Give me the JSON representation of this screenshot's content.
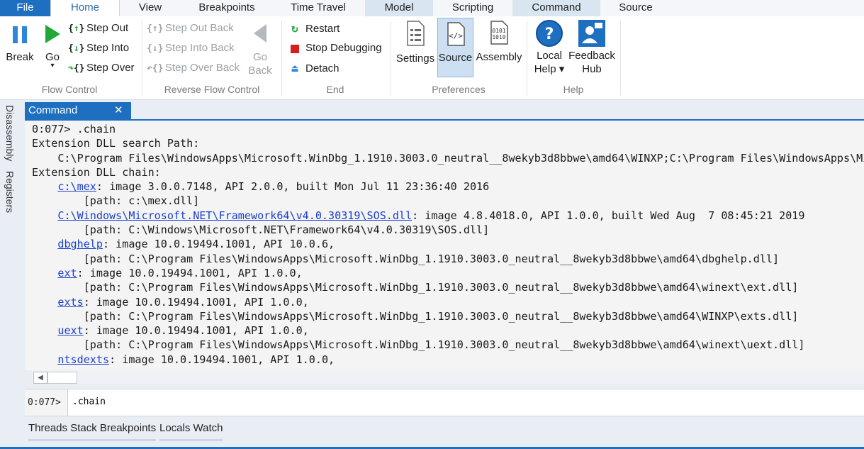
{
  "tabs": [
    "File",
    "Home",
    "View",
    "Breakpoints",
    "Time Travel",
    "Model",
    "Scripting",
    "Command",
    "Source"
  ],
  "ribbon": {
    "flow_control": {
      "label": "Flow Control",
      "break": "Break",
      "go": "Go",
      "go_arrow": "▾",
      "step_out": "Step Out",
      "step_into": "Step Into",
      "step_over": "Step Over"
    },
    "reverse_flow_control": {
      "label": "Reverse Flow Control",
      "step_out_back": "Step Out Back",
      "step_into_back": "Step Into Back",
      "step_over_back": "Step Over Back",
      "go_back_1": "Go",
      "go_back_2": "Back"
    },
    "end": {
      "label": "End",
      "restart": "Restart",
      "stop_debugging": "Stop Debugging",
      "detach": "Detach"
    },
    "preferences": {
      "label": "Preferences",
      "settings": "Settings",
      "source": "Source",
      "assembly": "Assembly"
    },
    "help": {
      "label": "Help",
      "local_help_1": "Local",
      "local_help_2": "Help ▾",
      "feedback_1": "Feedback",
      "feedback_2": "Hub"
    }
  },
  "side_tabs": [
    "Disassembly",
    "Registers"
  ],
  "command_window": {
    "title": "Command",
    "close_glyph": "✕",
    "output": [
      {
        "t": "0:077> .chain"
      },
      {
        "t": "Extension DLL search Path:"
      },
      {
        "t": "    C:\\Program Files\\WindowsApps\\Microsoft.WinDbg_1.1910.3003.0_neutral__8wekyb3d8bbwe\\amd64\\WINXP;C:\\Program Files\\WindowsApps\\Microsoft"
      },
      {
        "t": "Extension DLL chain:"
      },
      {
        "pre": "    ",
        "link": "c:\\mex",
        "t": ": image 3.0.0.7148, API 2.0.0, built Mon Jul 11 23:36:40 2016"
      },
      {
        "t": "        [path: c:\\mex.dll]"
      },
      {
        "pre": "    ",
        "link": "C:\\Windows\\Microsoft.NET\\Framework64\\v4.0.30319\\SOS.dll",
        "t": ": image 4.8.4018.0, API 1.0.0, built Wed Aug  7 08:45:21 2019"
      },
      {
        "t": "        [path: C:\\Windows\\Microsoft.NET\\Framework64\\v4.0.30319\\SOS.dll]"
      },
      {
        "pre": "    ",
        "link": "dbghelp",
        "t": ": image 10.0.19494.1001, API 10.0.6,"
      },
      {
        "t": "        [path: C:\\Program Files\\WindowsApps\\Microsoft.WinDbg_1.1910.3003.0_neutral__8wekyb3d8bbwe\\amd64\\dbghelp.dll]"
      },
      {
        "pre": "    ",
        "link": "ext",
        "t": ": image 10.0.19494.1001, API 1.0.0,"
      },
      {
        "t": "        [path: C:\\Program Files\\WindowsApps\\Microsoft.WinDbg_1.1910.3003.0_neutral__8wekyb3d8bbwe\\amd64\\winext\\ext.dll]"
      },
      {
        "pre": "    ",
        "link": "exts",
        "t": ": image 10.0.19494.1001, API 1.0.0,"
      },
      {
        "t": "        [path: C:\\Program Files\\WindowsApps\\Microsoft.WinDbg_1.1910.3003.0_neutral__8wekyb3d8bbwe\\amd64\\WINXP\\exts.dll]"
      },
      {
        "pre": "    ",
        "link": "uext",
        "t": ": image 10.0.19494.1001, API 1.0.0,"
      },
      {
        "t": "        [path: C:\\Program Files\\WindowsApps\\Microsoft.WinDbg_1.1910.3003.0_neutral__8wekyb3d8bbwe\\amd64\\winext\\uext.dll]"
      },
      {
        "pre": "    ",
        "link": "ntsdexts",
        "t": ": image 10.0.19494.1001, API 1.0.0,"
      }
    ],
    "prompt": "0:077>",
    "input_value": ".chain",
    "scroll_left_glyph": "◀"
  },
  "bottom_tabs": [
    "Threads Stack Breakpoints",
    "Locals Watch"
  ],
  "colors": {
    "accent": "#1e6fc0",
    "link": "#1a3fcf",
    "disabled": "#9aa0a6",
    "stop_red": "#d81e1e",
    "go_green": "#22a83a"
  },
  "icons": {
    "break": "pause-icon",
    "go": "play-icon",
    "step": "braces-icon",
    "go_back": "back-triangle-icon",
    "restart": "restart-icon",
    "stop": "stop-icon",
    "detach": "eject-icon",
    "settings": "document-list-icon",
    "source": "code-document-icon",
    "assembly": "binary-document-icon",
    "help": "question-icon",
    "feedback": "person-icon",
    "close": "close-icon"
  }
}
